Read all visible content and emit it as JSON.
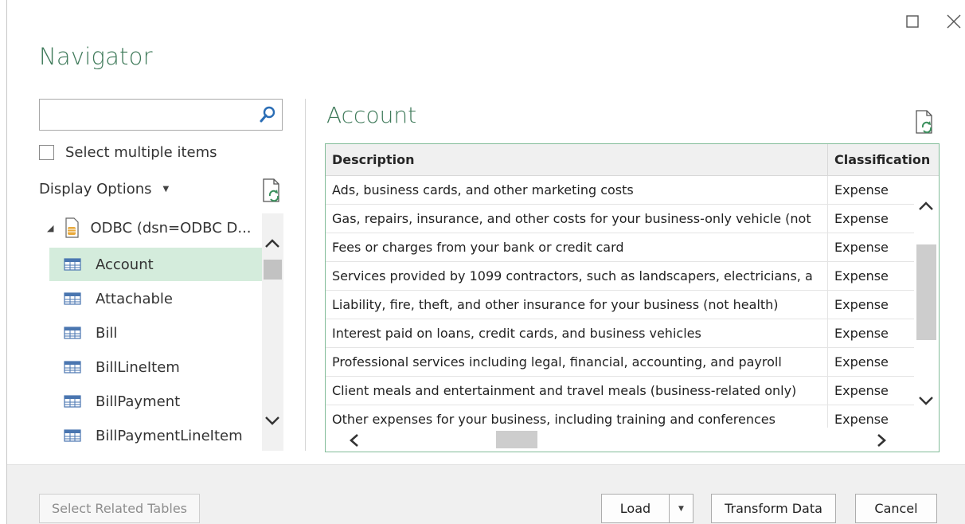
{
  "window": {
    "title": "Navigator",
    "maximize_icon": "maximize-icon",
    "close_icon": "close-icon"
  },
  "left_panel": {
    "search": {
      "value": "",
      "placeholder": "",
      "icon": "search-icon"
    },
    "select_multiple_label": "Select multiple items",
    "display_options_label": "Display Options",
    "refresh_icon": "refresh-icon",
    "tree": {
      "root_label": "ODBC (dsn=ODBC D...",
      "root_icon": "database-icon",
      "items": [
        {
          "label": "Account",
          "selected": true
        },
        {
          "label": "Attachable",
          "selected": false
        },
        {
          "label": "Bill",
          "selected": false
        },
        {
          "label": "BillLineItem",
          "selected": false
        },
        {
          "label": "BillPayment",
          "selected": false
        },
        {
          "label": "BillPaymentLineItem",
          "selected": false
        }
      ]
    }
  },
  "preview": {
    "title": "Account",
    "refresh_icon": "refresh-icon",
    "columns": [
      "Description",
      "Classification"
    ],
    "rows": [
      [
        "Ads, business cards, and other marketing costs",
        "Expense"
      ],
      [
        "Gas, repairs, insurance, and other costs for your business-only vehicle (not",
        "Expense"
      ],
      [
        "Fees or charges from your bank or credit card",
        "Expense"
      ],
      [
        "Services provided by 1099 contractors, such as landscapers, electricians, a",
        "Expense"
      ],
      [
        "Liability, fire, theft, and other insurance for your business (not health)",
        "Expense"
      ],
      [
        "Interest paid on loans, credit cards, and business vehicles",
        "Expense"
      ],
      [
        "Professional services including legal, financial, accounting, and payroll",
        "Expense"
      ],
      [
        "Client meals and entertainment and travel meals (business-related only)",
        "Expense"
      ],
      [
        "Other expenses for your business, including training and conferences",
        "Expense"
      ]
    ]
  },
  "footer": {
    "select_related_label": "Select Related Tables",
    "load_label": "Load",
    "transform_label": "Transform Data",
    "cancel_label": "Cancel"
  },
  "colors": {
    "accent": "#3f7a5a",
    "selection": "#d4ecdc",
    "grid_border": "#82bc99"
  }
}
